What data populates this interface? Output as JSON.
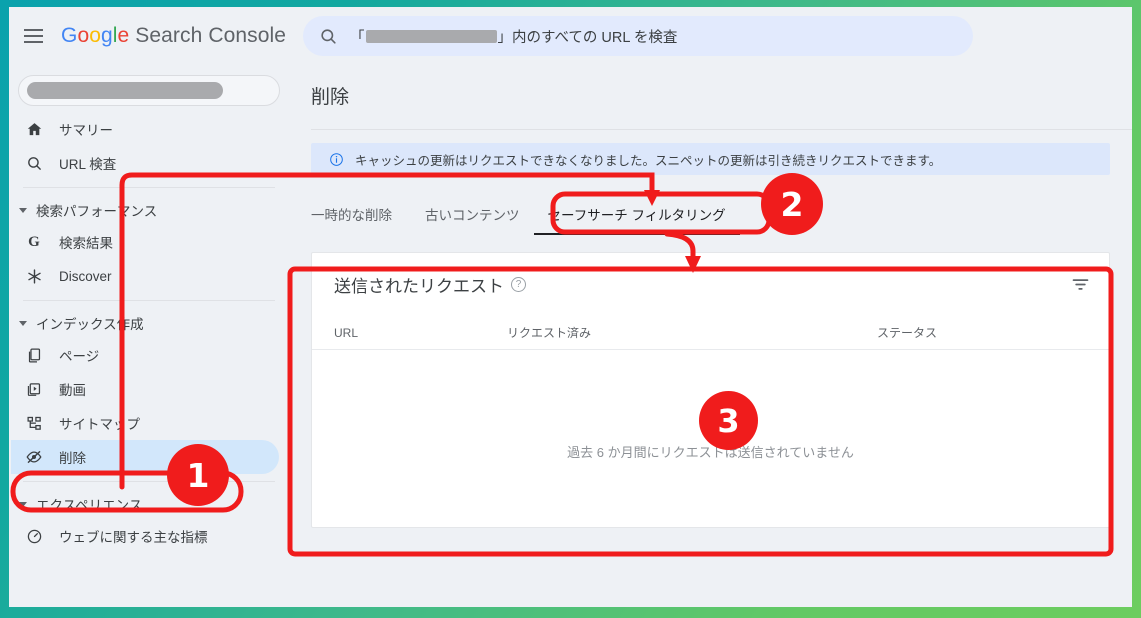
{
  "app": {
    "brand_google": "Google",
    "brand_rest": " Search Console",
    "hamburger_label": "menu-icon"
  },
  "search": {
    "icon": "search-icon",
    "prefix": "「",
    "redacted": "",
    "suffix": "」内のすべての URL を検査"
  },
  "sidebar": {
    "property_redacted": "",
    "items": [
      {
        "label": "サマリー",
        "icon": "home-icon",
        "active": false
      },
      {
        "label": "URL 検査",
        "icon": "search-icon",
        "active": false
      }
    ],
    "group_performance": {
      "label": "検索パフォーマンス",
      "icon": "chevron-down-icon"
    },
    "performance_items": [
      {
        "label": "検索結果",
        "icon": "google-g-icon",
        "active": false
      },
      {
        "label": "Discover",
        "icon": "discover-asterisk-icon",
        "active": false
      }
    ],
    "group_indexing": {
      "label": "インデックス作成",
      "icon": "chevron-down-icon"
    },
    "indexing_items": [
      {
        "label": "ページ",
        "icon": "pages-icon",
        "active": false
      },
      {
        "label": "動画",
        "icon": "video-icon",
        "active": false
      },
      {
        "label": "サイトマップ",
        "icon": "sitemap-icon",
        "active": false
      },
      {
        "label": "削除",
        "icon": "eye-off-icon",
        "active": true
      }
    ],
    "group_experience": {
      "label": "エクスペリエンス",
      "icon": "chevron-down-icon"
    },
    "experience_items": [
      {
        "label": "ウェブに関する主な指標",
        "icon": "speedometer-icon",
        "active": false
      }
    ]
  },
  "main": {
    "page_title": "削除",
    "banner": {
      "icon": "info-icon",
      "text": "キャッシュの更新はリクエストできなくなりました。スニペットの更新は引き続きリクエストできます。"
    },
    "tabs": [
      {
        "label": "一時的な削除",
        "active": false
      },
      {
        "label": "古いコンテンツ",
        "active": false
      },
      {
        "label": "セーフサーチ フィルタリング",
        "active": true
      }
    ],
    "card": {
      "title": "送信されたリクエスト",
      "help_icon": "help-circle-icon",
      "filter_icon": "filter-icon",
      "columns": [
        "URL",
        "リクエスト済み",
        "ステータス"
      ],
      "rows": [],
      "empty_text": "過去 6 か月間にリクエストは送信されていません"
    }
  },
  "annotations": {
    "badge1": "1",
    "badge2": "2",
    "badge3": "3",
    "color": "#f01c1c"
  },
  "frame": {
    "gradient_start": "#0aa2ad",
    "gradient_end": "#6dcd5f"
  }
}
